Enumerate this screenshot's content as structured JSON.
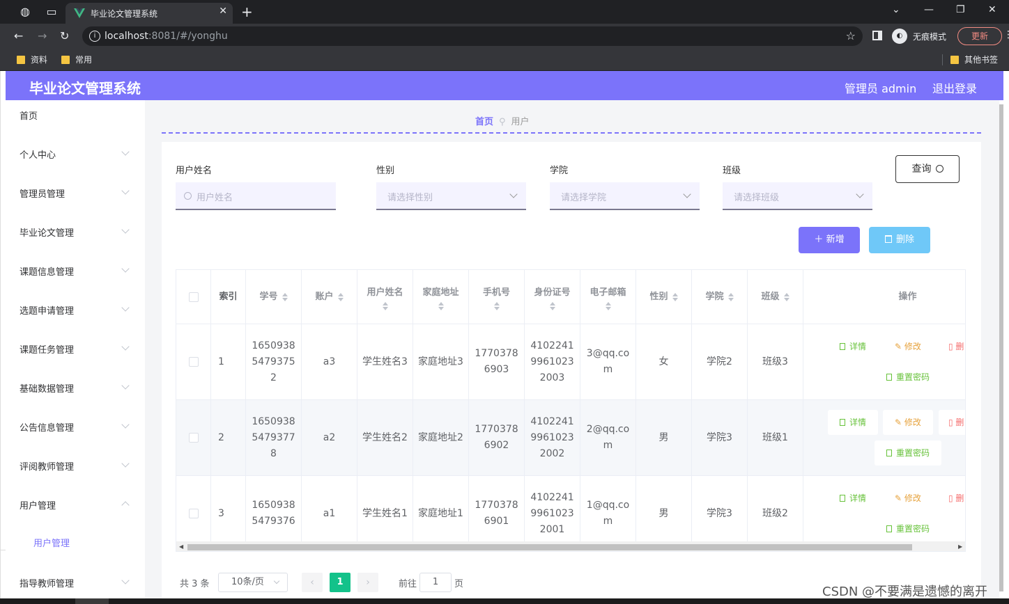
{
  "browser": {
    "tab_title": "毕业论文管理系统",
    "url_host": "localhost",
    "url_rest": ":8081/#/yonghu",
    "incognito_label": "无痕模式",
    "update_label": "更新",
    "bookmarks": [
      "资料",
      "常用"
    ],
    "other_bookmarks": "其他书签"
  },
  "header": {
    "title": "毕业论文管理系统",
    "admin": "管理员 admin",
    "logout": "退出登录"
  },
  "sidebar": {
    "items": [
      "首页",
      "个人中心",
      "管理员管理",
      "毕业论文管理",
      "课题信息管理",
      "选题申请管理",
      "课题任务管理",
      "基础数据管理",
      "公告信息管理",
      "评阅教师管理",
      "用户管理",
      "指导教师管理"
    ],
    "sub_item": "用户管理"
  },
  "breadcrumb": {
    "home": "首页",
    "current": "用户"
  },
  "filters": {
    "name_label": "用户姓名",
    "name_placeholder": "用户姓名",
    "gender_label": "性别",
    "gender_placeholder": "请选择性别",
    "college_label": "学院",
    "college_placeholder": "请选择学院",
    "class_label": "班级",
    "class_placeholder": "请选择班级",
    "query": "查询"
  },
  "actions": {
    "add": "新增",
    "delete": "删除"
  },
  "table": {
    "headers": {
      "index": "索引",
      "xuehao": "学号",
      "account": "账户",
      "name": "用户姓名",
      "address": "家庭地址",
      "phone": "手机号",
      "idcard": "身份证号",
      "email": "电子邮箱",
      "gender": "性别",
      "college": "学院",
      "class": "班级",
      "ops": "操作"
    },
    "rows": [
      {
        "index": "1",
        "xuehao": "16509385479375 2",
        "account": "a3",
        "name": "学生姓名3",
        "address": "家庭地址3",
        "phone": "17703786903",
        "idcard": "410224199610232003",
        "email": "3@qq.com",
        "gender": "女",
        "college": "学院2",
        "class": "班级3"
      },
      {
        "index": "2",
        "xuehao": "16509385479377 8",
        "account": "a2",
        "name": "学生姓名2",
        "address": "家庭地址2",
        "phone": "17703786902",
        "idcard": "410224199610232002",
        "email": "2@qq.com",
        "gender": "男",
        "college": "学院3",
        "class": "班级1"
      },
      {
        "index": "3",
        "xuehao": "16509385479376",
        "account": "a1",
        "name": "学生姓名1",
        "address": "家庭地址1",
        "phone": "17703786901",
        "idcard": "410224199610232001",
        "email": "1@qq.com",
        "gender": "男",
        "college": "学院3",
        "class": "班级2"
      }
    ],
    "op_labels": {
      "detail": "详情",
      "edit": "修改",
      "delete": "删",
      "reset": "重置密码"
    }
  },
  "pagination": {
    "total": "共 3 条",
    "page_size": "10条/页",
    "current": "1",
    "goto_prefix": "前往",
    "goto_value": "1",
    "goto_suffix": "页"
  },
  "watermark": "CSDN @不要满是遗憾的离开",
  "colors": {
    "brand": "#7b73fa",
    "delete_btn": "#6fc8f8",
    "page_current": "#13c28a"
  }
}
